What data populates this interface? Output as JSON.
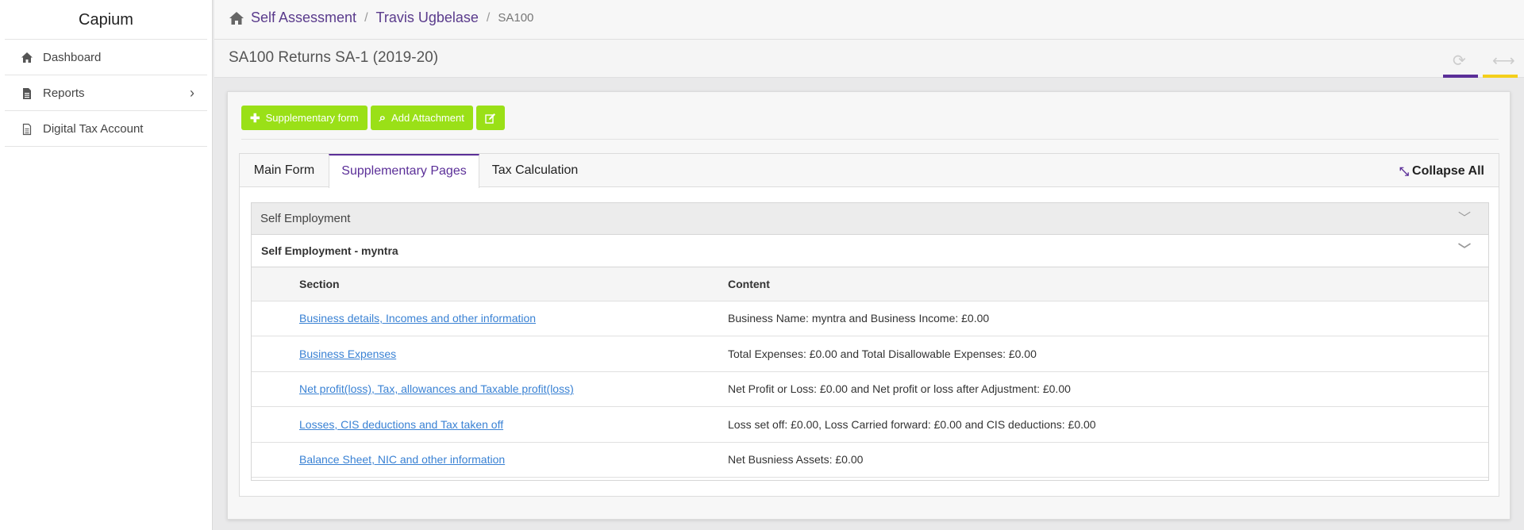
{
  "sidebar": {
    "brand": "Capium",
    "items": [
      {
        "label": "Dashboard",
        "icon": "home-icon"
      },
      {
        "label": "Reports",
        "icon": "document-icon"
      },
      {
        "label": "Digital Tax Account",
        "icon": "document-outline-icon"
      }
    ]
  },
  "breadcrumb": {
    "home_icon": "home-icon",
    "items": [
      "Self Assessment",
      "Travis Ugbelase"
    ],
    "current": "SA100"
  },
  "page": {
    "title": "SA100 Returns SA-1 (2019-20)",
    "tools": [
      "refresh-icon",
      "expand-icon"
    ],
    "tool_colors": {
      "refresh": "#5b2f98",
      "expand": "#f4cf1b"
    }
  },
  "actions": {
    "supplementary_form": "Supplementary form",
    "add_attachment": "Add Attachment",
    "edit_icon": "edit-icon",
    "color": "#9ae017"
  },
  "tabs": [
    "Main Form",
    "Supplementary Pages",
    "Tax Calculation"
  ],
  "active_tab": "Supplementary Pages",
  "collapse_all": "Collapse All",
  "accordion": {
    "title": "Self Employment",
    "subtitle": "Self Employment - myntra",
    "columns": [
      "Section",
      "Content"
    ],
    "rows": [
      {
        "section": "Business details, Incomes and other information",
        "content": "Business Name: myntra and Business Income: £0.00"
      },
      {
        "section": "Business Expenses",
        "content": "Total Expenses: £0.00 and Total Disallowable Expenses: £0.00"
      },
      {
        "section": "Net profit(loss), Tax, allowances and Taxable profit(loss)",
        "content": "Net Profit or Loss: £0.00 and Net profit or loss after Adjustment: £0.00"
      },
      {
        "section": "Losses, CIS deductions and Tax taken off",
        "content": "Loss set off: £0.00, Loss Carried forward: £0.00 and CIS deductions: £0.00"
      },
      {
        "section": "Balance Sheet, NIC and other information",
        "content": "Net Busniess Assets: £0.00"
      }
    ]
  }
}
